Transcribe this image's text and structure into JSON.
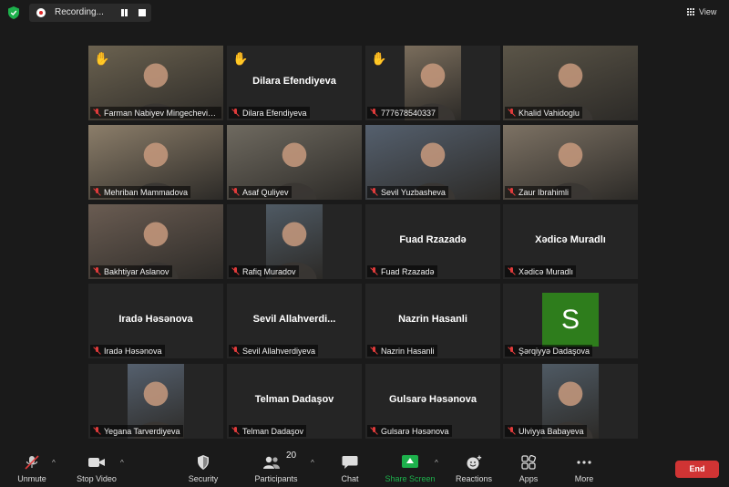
{
  "topbar": {
    "recording_label": "Recording...",
    "view_label": "View"
  },
  "tiles": [
    {
      "name_tag": "Farman Nabiyev  Mingechevir ...",
      "center_name": "",
      "hand_raised": true,
      "active": true,
      "video": "camera"
    },
    {
      "name_tag": "Dilara Efendiyeva",
      "center_name": "Dilara Efendiyeva",
      "hand_raised": true,
      "active": false,
      "video": "none"
    },
    {
      "name_tag": "777678540337",
      "center_name": "",
      "hand_raised": true,
      "active": false,
      "video": "camera-small"
    },
    {
      "name_tag": "Khalid Vahidoglu",
      "center_name": "",
      "hand_raised": false,
      "active": false,
      "video": "camera"
    },
    {
      "name_tag": "Mehriban Mammadova",
      "center_name": "",
      "hand_raised": false,
      "active": false,
      "video": "camera"
    },
    {
      "name_tag": "Asaf Quliyev",
      "center_name": "",
      "hand_raised": false,
      "active": false,
      "video": "camera"
    },
    {
      "name_tag": "Sevil Yuzbasheva",
      "center_name": "",
      "hand_raised": false,
      "active": false,
      "video": "camera"
    },
    {
      "name_tag": "Zaur  Ibrahimli",
      "center_name": "",
      "hand_raised": false,
      "active": false,
      "video": "camera"
    },
    {
      "name_tag": "Bakhtiyar Aslanov",
      "center_name": "",
      "hand_raised": false,
      "active": false,
      "video": "camera"
    },
    {
      "name_tag": "Rafiq Muradov",
      "center_name": "",
      "hand_raised": false,
      "active": false,
      "video": "camera-small"
    },
    {
      "name_tag": "Fuad Rzazadə",
      "center_name": "Fuad Rzazadə",
      "hand_raised": false,
      "active": false,
      "video": "none"
    },
    {
      "name_tag": "Xədicə Muradlı",
      "center_name": "Xədicə Muradlı",
      "hand_raised": false,
      "active": false,
      "video": "none"
    },
    {
      "name_tag": "Iradə Həsənova",
      "center_name": "Iradə Həsənova",
      "hand_raised": false,
      "active": false,
      "video": "none"
    },
    {
      "name_tag": "Sevil Allahverdiyeva",
      "center_name": "Sevil  Allahverdi...",
      "hand_raised": false,
      "active": false,
      "video": "none"
    },
    {
      "name_tag": "Nazrin Hasanli",
      "center_name": "Nazrin Hasanli",
      "hand_raised": false,
      "active": false,
      "video": "none"
    },
    {
      "name_tag": "Şərqiyyə Dadaşova",
      "center_name": "",
      "hand_raised": false,
      "active": false,
      "video": "avatar",
      "avatar_letter": "S"
    },
    {
      "name_tag": "Yegana Tarverdiyeva",
      "center_name": "",
      "hand_raised": false,
      "active": false,
      "video": "camera-small"
    },
    {
      "name_tag": "Telman Dadaşov",
      "center_name": "Telman Dadaşov",
      "hand_raised": false,
      "active": false,
      "video": "none"
    },
    {
      "name_tag": "Gulsarə Həsənova",
      "center_name": "Gulsarə Həsənova",
      "hand_raised": false,
      "active": false,
      "video": "none"
    },
    {
      "name_tag": "Ulviyya Babayeva",
      "center_name": "",
      "hand_raised": false,
      "active": false,
      "video": "camera-small"
    }
  ],
  "toolbar": {
    "unmute": "Unmute",
    "stop_video": "Stop Video",
    "security": "Security",
    "participants": "Participants",
    "participants_count": "20",
    "chat": "Chat",
    "share_screen": "Share Screen",
    "reactions": "Reactions",
    "apps": "Apps",
    "more": "More",
    "end": "End"
  },
  "colors": {
    "background": "#1a1a1a",
    "tile": "#252525",
    "active_outline": "#c9d84c",
    "muted_icon": "#e03b3b",
    "share_green": "#1db14c",
    "end_red": "#d03434",
    "avatar_green": "#2e7d1c"
  }
}
